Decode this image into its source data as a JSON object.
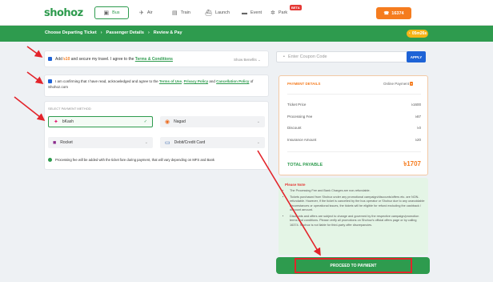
{
  "brand": {
    "logo": "shohoz"
  },
  "nav": {
    "bus": "Bus",
    "air": "Air",
    "train": "Train",
    "launch": "Launch",
    "event": "Event",
    "park": "Park",
    "beta": "BETA",
    "phone": "16374"
  },
  "breadcrumb": {
    "step1": "Choose Departing Ticket",
    "step2": "Passenger Details",
    "step3": "Review & Pay",
    "timer": "05m26s"
  },
  "insurance": {
    "text_a": "Add",
    "amount": "৳10",
    "text_b": "and secure my travel. I agree to the",
    "link": "Terms & Conditions",
    "show_benefits": "Show Benefits"
  },
  "terms": {
    "text_a": "I am confirming that I have read, acknowledged and agree to the",
    "link1": "Terms of Use",
    "link2": "Privacy Policy",
    "and": "and",
    "link3": "Cancellation Policy",
    "text_b": "of Shohoz.com"
  },
  "payment": {
    "section_label": "SELECT PAYMENT METHOD",
    "bkash": "bKash",
    "nagad": "Nagad",
    "rocket": "Rocket",
    "card": "Debit/Credit Card",
    "note": "Processing fee will be added with the ticket fare during payment, that will vary depending on MFS and Bank"
  },
  "coupon": {
    "placeholder": "Enter Coupon Code",
    "apply": "APPLY"
  },
  "details": {
    "title": "PAYMENT DETAILS",
    "mode": "Online Payment",
    "rows": [
      {
        "label": "Ticket Price",
        "value": "৳1600"
      },
      {
        "label": "Processing Fee",
        "value": "৳87"
      },
      {
        "label": "Discount",
        "value": "৳0"
      },
      {
        "label": "Insurance Amount",
        "value": "৳20"
      }
    ],
    "total_label": "TOTAL PAYABLE",
    "total_value": "৳1707"
  },
  "note": {
    "title": "Please Note",
    "items": [
      "The Processing Fee and Bank Charges are non-refundable.",
      "Tickets purchased from Shohoz under any promotional campaign/discounts/offers etc. are NON-refundable. However, if the ticket is cancelled by the bus operator or Shohoz due to any unavoidable circumstances or operational issues, the tickets will be eligible for refund excluding the cashback / discount amount.",
      "Discounts and offers are subject to change and governed by the respective campaign/promotion terms and conditions. Please verify all promotions on Shohoz's official offers page or by calling 16374. Shohoz is not liable for third-party offer discrepancies."
    ]
  },
  "proceed": {
    "label": "PROCEED TO PAYMENT"
  }
}
